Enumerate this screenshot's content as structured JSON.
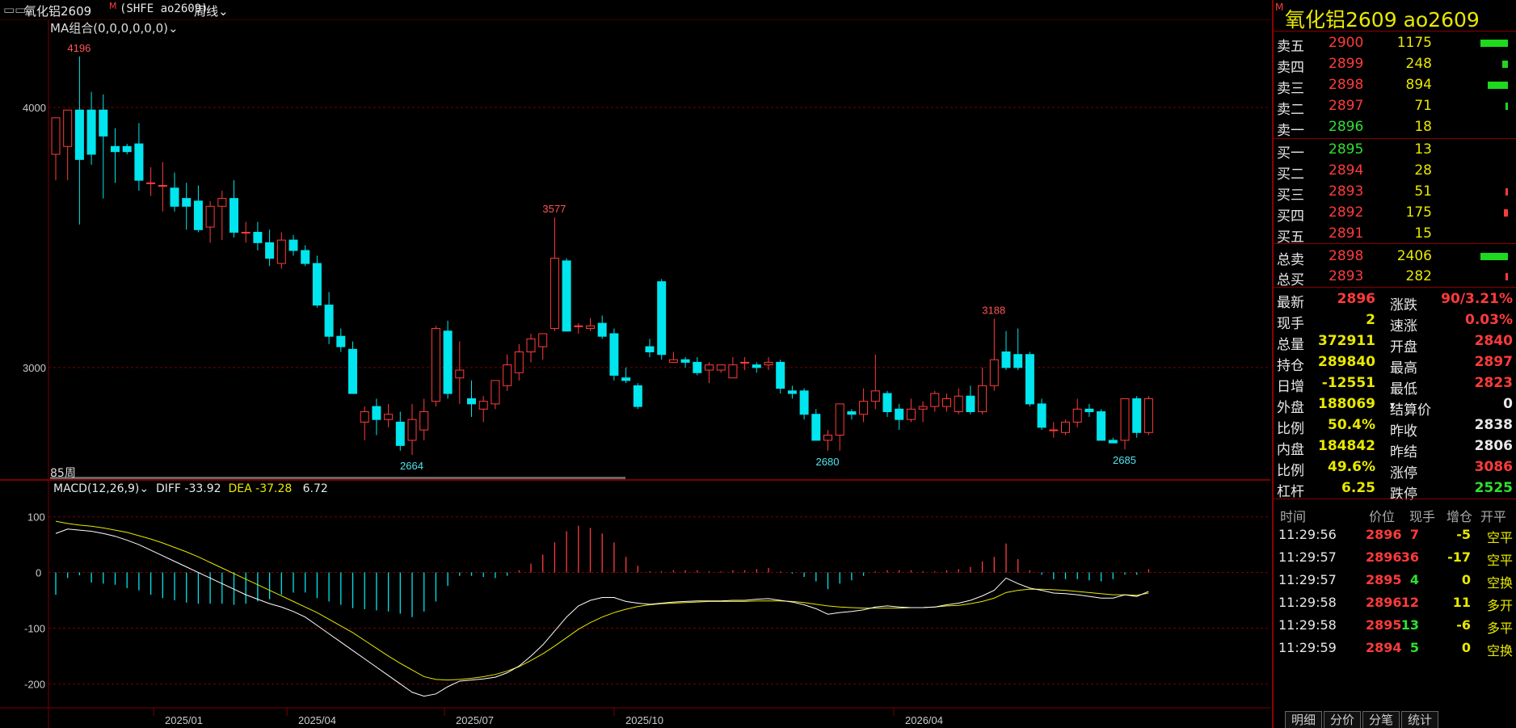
{
  "header": {
    "contract": "氧化铝2609",
    "code": "(SHFE ao2609)",
    "period": "周线",
    "ma_label": "MA组合(0,0,0,0,0,0)",
    "bars_label": "85周",
    "macd_label": "MACD(12,26,9)",
    "diff": "DIFF -33.92",
    "dea": "DEA -37.28",
    "macd_val": "6.72"
  },
  "colors": {
    "up": "#ff3b3b",
    "down": "#00e5ee",
    "grid": "#7a0000",
    "diff": "#ffffff",
    "dea": "#e8e800"
  },
  "chart_data": {
    "type": "candlestick",
    "y_ticks": [
      "4000",
      "3000"
    ],
    "ylim": [
      2580,
      4320
    ],
    "macd_ticks": [
      "100",
      "0",
      "-100",
      "-200"
    ],
    "macd_ylim": [
      -240,
      140
    ],
    "x_ticks": [
      "2025/01",
      "2025/04",
      "2025/07",
      "2025/10",
      "2026/04"
    ],
    "annotations": [
      "4196",
      "2664",
      "3577",
      "2680",
      "3188",
      "2685"
    ],
    "candles": [
      [
        3820,
        3960,
        3720,
        3960
      ],
      [
        3850,
        3990,
        3720,
        3990
      ],
      [
        3990,
        4196,
        3550,
        3800
      ],
      [
        3990,
        4060,
        3780,
        3820
      ],
      [
        3990,
        4050,
        3650,
        3890
      ],
      [
        3850,
        3920,
        3710,
        3830
      ],
      [
        3850,
        3860,
        3820,
        3830
      ],
      [
        3860,
        3940,
        3680,
        3720
      ],
      [
        3710,
        3770,
        3660,
        3710
      ],
      [
        3700,
        3790,
        3600,
        3700
      ],
      [
        3690,
        3750,
        3600,
        3620
      ],
      [
        3650,
        3710,
        3530,
        3620
      ],
      [
        3640,
        3700,
        3520,
        3530
      ],
      [
        3540,
        3640,
        3480,
        3620
      ],
      [
        3620,
        3680,
        3490,
        3650
      ],
      [
        3650,
        3720,
        3500,
        3520
      ],
      [
        3520,
        3560,
        3480,
        3520
      ],
      [
        3520,
        3560,
        3450,
        3480
      ],
      [
        3480,
        3530,
        3390,
        3420
      ],
      [
        3400,
        3520,
        3380,
        3490
      ],
      [
        3490,
        3510,
        3430,
        3450
      ],
      [
        3450,
        3470,
        3390,
        3400
      ],
      [
        3400,
        3430,
        3230,
        3240
      ],
      [
        3240,
        3290,
        3090,
        3120
      ],
      [
        3120,
        3150,
        3060,
        3080
      ],
      [
        3070,
        3100,
        2900,
        2900
      ],
      [
        2790,
        2850,
        2720,
        2830
      ],
      [
        2850,
        2880,
        2740,
        2800
      ],
      [
        2800,
        2860,
        2770,
        2820
      ],
      [
        2790,
        2830,
        2680,
        2700
      ],
      [
        2720,
        2860,
        2664,
        2800
      ],
      [
        2760,
        2880,
        2720,
        2830
      ],
      [
        2870,
        3160,
        2850,
        3150
      ],
      [
        3140,
        3180,
        2880,
        2900
      ],
      [
        2960,
        3100,
        2860,
        2990
      ],
      [
        2880,
        2950,
        2810,
        2860
      ],
      [
        2840,
        2890,
        2790,
        2870
      ],
      [
        2860,
        2950,
        2840,
        2950
      ],
      [
        2930,
        3050,
        2910,
        3010
      ],
      [
        2980,
        3090,
        2950,
        3060
      ],
      [
        3060,
        3130,
        3020,
        3110
      ],
      [
        3080,
        3130,
        3030,
        3130
      ],
      [
        3150,
        3577,
        3140,
        3420
      ],
      [
        3410,
        3420,
        3140,
        3140
      ],
      [
        3160,
        3170,
        3130,
        3160
      ],
      [
        3150,
        3190,
        3140,
        3160
      ],
      [
        3170,
        3200,
        3110,
        3120
      ],
      [
        3130,
        3150,
        2950,
        2970
      ],
      [
        2960,
        3000,
        2940,
        2950
      ],
      [
        2930,
        2940,
        2840,
        2850
      ],
      [
        3080,
        3110,
        3040,
        3060
      ],
      [
        3330,
        3340,
        3030,
        3050
      ],
      [
        3020,
        3060,
        3020,
        3030
      ],
      [
        3030,
        3040,
        3000,
        3020
      ],
      [
        3020,
        3040,
        2970,
        2980
      ],
      [
        2990,
        3020,
        2940,
        3010
      ],
      [
        2990,
        3010,
        2980,
        3010
      ],
      [
        2960,
        3040,
        2960,
        3010
      ],
      [
        3020,
        3040,
        2990,
        3020
      ],
      [
        3010,
        3020,
        2980,
        3000
      ],
      [
        3010,
        3040,
        2990,
        3020
      ],
      [
        3020,
        3030,
        2900,
        2920
      ],
      [
        2910,
        2930,
        2880,
        2900
      ],
      [
        2910,
        2920,
        2800,
        2820
      ],
      [
        2820,
        2840,
        2720,
        2720
      ],
      [
        2720,
        2760,
        2680,
        2740
      ],
      [
        2740,
        2860,
        2680,
        2860
      ],
      [
        2830,
        2840,
        2800,
        2820
      ],
      [
        2820,
        2920,
        2790,
        2870
      ],
      [
        2870,
        3050,
        2840,
        2910
      ],
      [
        2900,
        2910,
        2810,
        2830
      ],
      [
        2840,
        2860,
        2760,
        2800
      ],
      [
        2800,
        2880,
        2790,
        2840
      ],
      [
        2840,
        2870,
        2790,
        2850
      ],
      [
        2850,
        2910,
        2830,
        2900
      ],
      [
        2850,
        2900,
        2830,
        2880
      ],
      [
        2830,
        2920,
        2820,
        2890
      ],
      [
        2890,
        2930,
        2820,
        2830
      ],
      [
        2830,
        3000,
        2820,
        2930
      ],
      [
        2930,
        3188,
        2910,
        3030
      ],
      [
        3060,
        3140,
        2990,
        3000
      ],
      [
        3050,
        3150,
        2990,
        3000
      ],
      [
        3050,
        3060,
        2850,
        2860
      ],
      [
        2860,
        2880,
        2760,
        2770
      ],
      [
        2760,
        2790,
        2730,
        2760
      ],
      [
        2750,
        2800,
        2740,
        2790
      ],
      [
        2790,
        2880,
        2770,
        2840
      ],
      [
        2840,
        2860,
        2810,
        2830
      ],
      [
        2830,
        2840,
        2720,
        2720
      ],
      [
        2720,
        2730,
        2710,
        2710
      ],
      [
        2720,
        2880,
        2685,
        2880
      ],
      [
        2880,
        2890,
        2730,
        2750
      ],
      [
        2750,
        2890,
        2740,
        2880
      ]
    ],
    "macd": {
      "diff": [
        70,
        78,
        76,
        74,
        70,
        65,
        58,
        50,
        40,
        30,
        20,
        10,
        0,
        -10,
        -20,
        -30,
        -40,
        -48,
        -56,
        -62,
        -70,
        -80,
        -95,
        -110,
        -125,
        -140,
        -155,
        -170,
        -185,
        -200,
        -215,
        -222,
        -218,
        -205,
        -195,
        -193,
        -191,
        -188,
        -180,
        -168,
        -150,
        -130,
        -105,
        -80,
        -60,
        -50,
        -45,
        -45,
        -52,
        -55,
        -57,
        -55,
        -53,
        -52,
        -51,
        -51,
        -51,
        -50,
        -50,
        -48,
        -47,
        -50,
        -53,
        -58,
        -65,
        -75,
        -72,
        -70,
        -67,
        -62,
        -60,
        -62,
        -63,
        -63,
        -62,
        -58,
        -55,
        -50,
        -42,
        -32,
        -10,
        -20,
        -28,
        -32,
        -37,
        -38,
        -40,
        -43,
        -46,
        -46,
        -40,
        -43,
        -34
      ],
      "dea": [
        92,
        88,
        85,
        83,
        80,
        76,
        72,
        66,
        60,
        53,
        45,
        37,
        28,
        18,
        8,
        -2,
        -12,
        -22,
        -32,
        -42,
        -52,
        -62,
        -72,
        -84,
        -96,
        -108,
        -122,
        -136,
        -150,
        -163,
        -175,
        -187,
        -192,
        -193,
        -192,
        -190,
        -187,
        -183,
        -177,
        -169,
        -158,
        -146,
        -132,
        -117,
        -102,
        -90,
        -80,
        -72,
        -66,
        -61,
        -58,
        -56,
        -55,
        -54,
        -53,
        -52,
        -52,
        -52,
        -52,
        -51,
        -51,
        -51,
        -52,
        -54,
        -57,
        -60,
        -62,
        -63,
        -64,
        -64,
        -64,
        -64,
        -63,
        -63,
        -62,
        -60,
        -59,
        -56,
        -52,
        -46,
        -36,
        -32,
        -30,
        -30,
        -31,
        -32,
        -34,
        -36,
        -38,
        -40,
        -40,
        -41,
        -37
      ],
      "hist": [
        -40,
        -10,
        -5,
        -18,
        -20,
        -22,
        -28,
        -32,
        -40,
        -46,
        -50,
        -54,
        -56,
        -56,
        -56,
        -58,
        -56,
        -52,
        -48,
        -40,
        -36,
        -36,
        -46,
        -52,
        -58,
        -64,
        -66,
        -68,
        -70,
        -74,
        -80,
        -70,
        -52,
        -24,
        -6,
        -6,
        -8,
        -10,
        -6,
        4,
        16,
        32,
        54,
        74,
        84,
        80,
        70,
        54,
        28,
        12,
        2,
        2,
        4,
        4,
        4,
        2,
        2,
        4,
        4,
        6,
        8,
        2,
        -2,
        -8,
        -16,
        -30,
        -20,
        -14,
        -6,
        2,
        4,
        4,
        4,
        2,
        2,
        4,
        6,
        10,
        20,
        28,
        52,
        24,
        4,
        -4,
        -12,
        -12,
        -12,
        -14,
        -16,
        -12,
        -4,
        -4,
        6
      ]
    }
  },
  "panel": {
    "title": "氧化铝2609  ao2609",
    "title_badge": "M",
    "asks": [
      {
        "label": "卖五",
        "price": "2900",
        "vol": "1175",
        "bar": 1.0
      },
      {
        "label": "卖四",
        "price": "2899",
        "vol": "248",
        "bar": 0.2
      },
      {
        "label": "卖三",
        "price": "2898",
        "vol": "894",
        "bar": 0.75
      },
      {
        "label": "卖二",
        "price": "2897",
        "vol": "71",
        "bar": 0.06
      },
      {
        "label": "卖一",
        "price": "2896",
        "vol": "18",
        "bar": 0.0
      }
    ],
    "bids": [
      {
        "label": "买一",
        "price": "2895",
        "vol": "13",
        "bar": 0.0
      },
      {
        "label": "买二",
        "price": "2894",
        "vol": "28",
        "bar": 0.0
      },
      {
        "label": "买三",
        "price": "2893",
        "vol": "51",
        "bar": 0.04
      },
      {
        "label": "买四",
        "price": "2892",
        "vol": "175",
        "bar": 0.15
      },
      {
        "label": "买五",
        "price": "2891",
        "vol": "15",
        "bar": 0.0
      }
    ],
    "totals": [
      {
        "label": "总卖",
        "price": "2898",
        "vol": "2406",
        "bar": 1.0,
        "barcolor": "grn"
      },
      {
        "label": "总买",
        "price": "2893",
        "vol": "282",
        "bar": 0.1,
        "barcolor": "red"
      }
    ],
    "stats": [
      {
        "l1": "最新",
        "v1": "2896",
        "c1": "red",
        "l2": "涨跌",
        "v2": "90/3.21%",
        "c2": "red"
      },
      {
        "l1": "现手",
        "v1": "2",
        "c1": "yel",
        "l2": "速涨",
        "v2": "0.03%",
        "c2": "red"
      },
      {
        "l1": "总量",
        "v1": "372911",
        "c1": "yel",
        "l2": "开盘",
        "v2": "2840",
        "c2": "red"
      },
      {
        "l1": "持仓",
        "v1": "289840",
        "c1": "yel",
        "l2": "最高",
        "v2": "2897",
        "c2": "red"
      },
      {
        "l1": "日增",
        "v1": "-12551",
        "c1": "yel",
        "l2": "最低",
        "v2": "2823",
        "c2": "red"
      },
      {
        "l1": "外盘",
        "v1": "188069",
        "c1": "yel",
        "l2": "结算价",
        "v2": "0",
        "c2": "wht"
      },
      {
        "l1": "比例",
        "v1": "50.4%",
        "c1": "yel",
        "l2": "昨收",
        "v2": "2838",
        "c2": "wht"
      },
      {
        "l1": "内盘",
        "v1": "184842",
        "c1": "yel",
        "l2": "昨结",
        "v2": "2806",
        "c2": "wht"
      },
      {
        "l1": "比例",
        "v1": "49.6%",
        "c1": "yel",
        "l2": "涨停",
        "v2": "3086",
        "c2": "red"
      },
      {
        "l1": "杠杆",
        "v1": "6.25",
        "c1": "yel",
        "l2": "跌停",
        "v2": "2525",
        "c2": "grn"
      }
    ],
    "tick_headers": [
      "时间",
      "价位",
      "现手",
      "增仓",
      "开平"
    ],
    "ticks": [
      {
        "time": "11:29:56",
        "price": "2896",
        "pc": "red",
        "vol": "7",
        "vc": "red",
        "oi": "-5",
        "type": "空平",
        "tc": "yel"
      },
      {
        "time": "11:29:57",
        "price": "2896",
        "pc": "red",
        "vol": "36",
        "vc": "red",
        "oi": "-17",
        "type": "空平",
        "tc": "yel"
      },
      {
        "time": "11:29:57",
        "price": "2895",
        "pc": "red",
        "vol": "4",
        "vc": "grn",
        "oi": "0",
        "type": "空换",
        "tc": "yel"
      },
      {
        "time": "11:29:58",
        "price": "2896",
        "pc": "red",
        "vol": "12",
        "vc": "red",
        "oi": "11",
        "type": "多开",
        "tc": "yel"
      },
      {
        "time": "11:29:58",
        "price": "2895",
        "pc": "red",
        "vol": "13",
        "vc": "grn",
        "oi": "-6",
        "type": "多平",
        "tc": "yel"
      },
      {
        "time": "11:29:59",
        "price": "2894",
        "pc": "red",
        "vol": "5",
        "vc": "grn",
        "oi": "0",
        "type": "空换",
        "tc": "yel"
      }
    ],
    "tabs": [
      "明细",
      "分价",
      "分笔",
      "统计"
    ]
  }
}
